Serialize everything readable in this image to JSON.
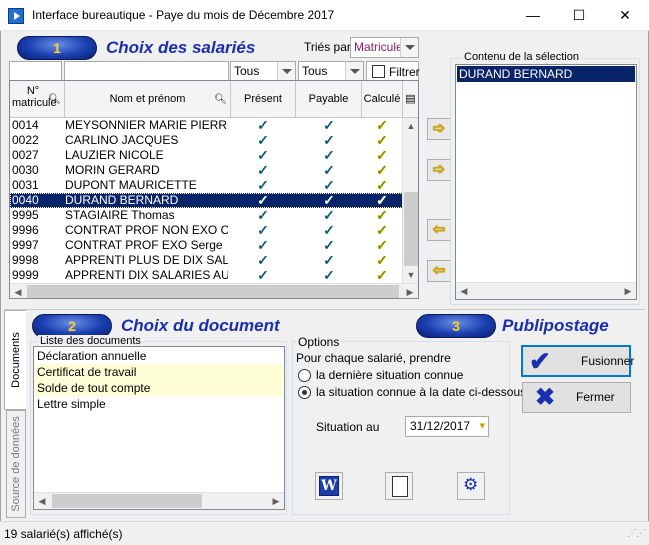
{
  "window": {
    "title": "Interface bureautique - Paye du mois de Décembre 2017",
    "minimize": "—",
    "maximize": "☐",
    "close": "✕"
  },
  "section1": {
    "number": "1",
    "title": "Choix des salariés",
    "sort_label": "Triés par",
    "sort_value": "Matricule",
    "filter_present": "Tous",
    "filter_payable": "Tous",
    "filter_checkbox_label": "Filtrer"
  },
  "grid": {
    "headers": {
      "matricule": "N° matricule",
      "name": "Nom et prénom",
      "present": "Présent",
      "payable": "Payable",
      "calcule": "Calculé"
    },
    "rows": [
      {
        "matricule": "0014",
        "name": "MEYSONNIER MARIE PIERRE",
        "present": true,
        "payable": true,
        "calcule": true,
        "selected": false
      },
      {
        "matricule": "0022",
        "name": "CARLINO JACQUES",
        "present": true,
        "payable": true,
        "calcule": true,
        "selected": false
      },
      {
        "matricule": "0027",
        "name": "LAUZIER NICOLE",
        "present": true,
        "payable": true,
        "calcule": true,
        "selected": false
      },
      {
        "matricule": "0030",
        "name": "MORIN GERARD",
        "present": true,
        "payable": true,
        "calcule": true,
        "selected": false
      },
      {
        "matricule": "0031",
        "name": "DUPONT MAURICETTE",
        "present": true,
        "payable": true,
        "calcule": true,
        "selected": false
      },
      {
        "matricule": "0040",
        "name": "DURAND BERNARD",
        "present": true,
        "payable": true,
        "calcule": true,
        "selected": true
      },
      {
        "matricule": "9995",
        "name": "STAGIAIRE Thomas",
        "present": true,
        "payable": true,
        "calcule": true,
        "selected": false
      },
      {
        "matricule": "9996",
        "name": "CONTRAT PROF NON EXO Olivie",
        "present": true,
        "payable": true,
        "calcule": true,
        "selected": false
      },
      {
        "matricule": "9997",
        "name": "CONTRAT PROF EXO Serge",
        "present": true,
        "payable": true,
        "calcule": true,
        "selected": false
      },
      {
        "matricule": "9998",
        "name": "APPRENTI PLUS DE DIX SALAR",
        "present": true,
        "payable": true,
        "calcule": true,
        "selected": false
      },
      {
        "matricule": "9999",
        "name": "APPRENTI DIX SALARIES AU PL",
        "present": true,
        "payable": true,
        "calcule": true,
        "selected": false
      }
    ],
    "check_glyph": "✓"
  },
  "move_buttons": {
    "add": "➩",
    "add_all": "➩",
    "remove": "⇦",
    "remove_all": "⇦"
  },
  "selection": {
    "legend": "Contenu de la sélection",
    "items": [
      "DURAND BERNARD"
    ]
  },
  "tabs": {
    "documents": "Documents",
    "source": "Source de données"
  },
  "section2": {
    "number": "2",
    "title": "Choix du document",
    "list_legend": "Liste des documents",
    "documents": [
      {
        "label": "Déclaration annuelle",
        "highlighted": false
      },
      {
        "label": "Certificat de travail",
        "highlighted": true
      },
      {
        "label": "Solde de tout compte",
        "highlighted": true
      },
      {
        "label": "Lettre simple",
        "highlighted": false
      }
    ],
    "options_legend": "Options",
    "options_intro": "Pour chaque salarié, prendre",
    "option_last": "la dernière situation connue",
    "option_date": "la situation connue à la date ci-dessous",
    "situation_label": "Situation au",
    "situation_date": "31/12/2017"
  },
  "section3": {
    "number": "3",
    "title": "Publipostage",
    "merge_label": "Fusionner",
    "close_label": "Fermer"
  },
  "toolbar": {
    "word_glyph": "W"
  },
  "status": {
    "text": "19 salarié(s) affiché(s)"
  },
  "colors": {
    "accent_blue": "#1a2fb0",
    "selection": "#0a246a",
    "badge_digit": "#ffd21f",
    "highlight_row": "#ffffd7"
  }
}
